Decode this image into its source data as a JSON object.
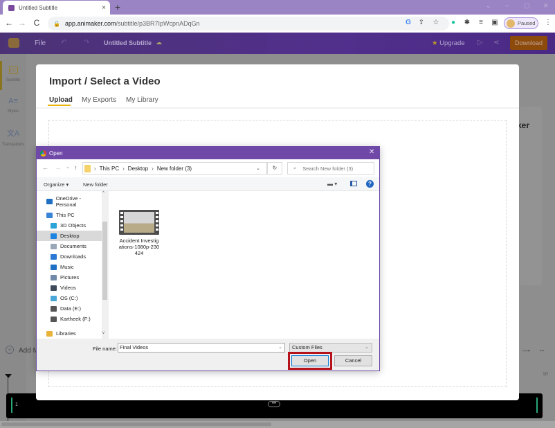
{
  "browser": {
    "tab_title": "Untitled Subtitle",
    "tab_close": "×",
    "new_tab": "+",
    "window_controls": [
      "⌄",
      "–",
      "▢",
      "✕"
    ],
    "url_domain": "app.animaker.com",
    "url_path": "/subtitle/p3BR7IpWcpnADqGn",
    "profile_status": "Paused",
    "nav": {
      "back": "←",
      "forward": "→",
      "reload": "C"
    },
    "toolbar_icons": [
      "G",
      "⇪",
      "☆",
      "●",
      "✱",
      "≡",
      "▣",
      "⋮"
    ]
  },
  "app_header": {
    "file_menu": "File",
    "undo": "↶",
    "redo": "↷",
    "project_title": "Untitled Subtitle",
    "cloud_icon": "☁",
    "upgrade_star": "★",
    "upgrade_label": "Upgrade",
    "play_icon": "▷",
    "share_icon": "⋖",
    "download_label": "Download"
  },
  "sidebar": {
    "items": [
      {
        "icon": "CC",
        "label": "Subtitle",
        "active": true
      },
      {
        "icon": "A≡",
        "label": "Styles",
        "active": false
      },
      {
        "icon": "文A",
        "label": "Translations",
        "active": false
      }
    ]
  },
  "background": {
    "side_card_text": "ker",
    "add_media_label": "Add M",
    "add_icon": "+",
    "zoom_slider_icon": "—•",
    "fit_icon": "↔",
    "timeline_end_label": "10",
    "track_label": "1",
    "track_grip": "•••"
  },
  "import_modal": {
    "title": "Import / Select a Video",
    "tabs": [
      {
        "label": "Upload",
        "active": true
      },
      {
        "label": "My Exports",
        "active": false
      },
      {
        "label": "My Library",
        "active": false
      }
    ]
  },
  "open_dialog": {
    "title": "Open",
    "close": "✕",
    "nav_buttons": {
      "back": "←",
      "forward": "→",
      "recent": "⌄",
      "up": "↑"
    },
    "breadcrumb": [
      "This PC",
      "Desktop",
      "New folder (3)"
    ],
    "breadcrumb_sep": "›",
    "path_dropdown": "⌄",
    "refresh_icon": "↻",
    "search_icon": "⌕",
    "search_placeholder": "Search New folder (3)",
    "organize_label": "Organize ▾",
    "new_folder_label": "New folder",
    "view_icon": "▬ ▾",
    "help_icon": "?",
    "nav_pane": [
      {
        "label": "OneDrive - Personal",
        "icon_color": "#1f6fc5",
        "indent": 1,
        "selected": false
      },
      {
        "label": "This PC",
        "icon_color": "#3a84d8",
        "indent": 1,
        "selected": false
      },
      {
        "label": "3D Objects",
        "icon_color": "#2aa3d8",
        "indent": 2,
        "selected": false
      },
      {
        "label": "Desktop",
        "icon_color": "#1e82e0",
        "indent": 2,
        "selected": true
      },
      {
        "label": "Documents",
        "icon_color": "#9aa7b8",
        "indent": 2,
        "selected": false
      },
      {
        "label": "Downloads",
        "icon_color": "#2a78d4",
        "indent": 2,
        "selected": false
      },
      {
        "label": "Music",
        "icon_color": "#1f6fc5",
        "indent": 2,
        "selected": false
      },
      {
        "label": "Pictures",
        "icon_color": "#6f8aa8",
        "indent": 2,
        "selected": false
      },
      {
        "label": "Videos",
        "icon_color": "#3d4a5a",
        "indent": 2,
        "selected": false
      },
      {
        "label": "OS (C:)",
        "icon_color": "#4aa8d8",
        "indent": 2,
        "selected": false
      },
      {
        "label": "Data (E:)",
        "icon_color": "#555555",
        "indent": 2,
        "selected": false
      },
      {
        "label": "Kartheek  (F:)",
        "icon_color": "#555555",
        "indent": 2,
        "selected": false
      },
      {
        "label": "Libraries",
        "icon_color": "#e8b33a",
        "indent": 1,
        "selected": false
      }
    ],
    "files": [
      {
        "name": "Accident Investigations-1080p-230424",
        "type": "video"
      }
    ],
    "file_name_label": "File name:",
    "file_name_value": "Final Videos",
    "file_type_value": "Custom Files",
    "open_label": "Open",
    "cancel_label": "Cancel",
    "highlight_color": "#b5121b"
  }
}
